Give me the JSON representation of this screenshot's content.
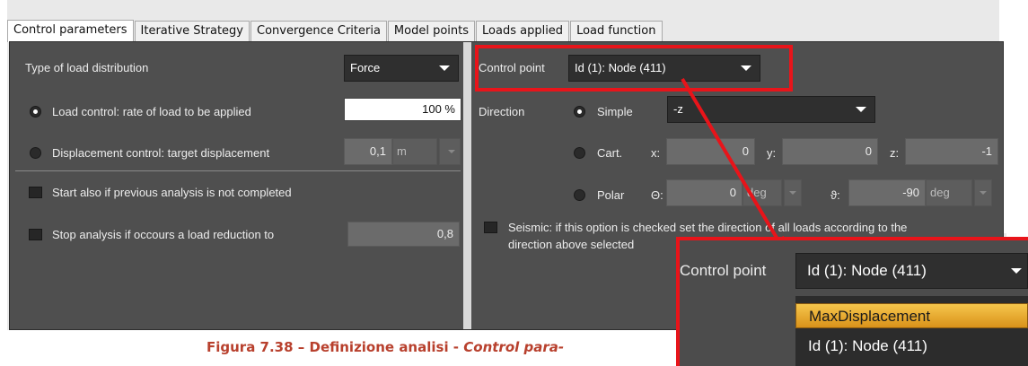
{
  "tabs": [
    "Control parameters",
    "Iterative Strategy",
    "Convergence Criteria",
    "Model points",
    "Loads applied",
    "Load function"
  ],
  "active_tab": "Control parameters",
  "left": {
    "load_distribution_label": "Type of load distribution",
    "load_distribution_value": "Force",
    "load_control_label": "Load control: rate of load to be applied",
    "load_control_value": "100 %",
    "displacement_control_label": "Displacement control: target displacement",
    "displacement_value": "0,1",
    "displacement_unit": "m",
    "start_also_label": "Start also if previous analysis is not completed",
    "stop_analysis_label": "Stop analysis if occours a load reduction to",
    "stop_analysis_value": "0,8"
  },
  "right": {
    "control_point_label": "Control point",
    "control_point_value": "Id (1): Node (411)",
    "direction_label": "Direction",
    "simple_label": "Simple",
    "simple_value": "-z",
    "cart_label": "Cart.",
    "x_label": "x:",
    "x_value": "0",
    "y_label": "y:",
    "y_value": "0",
    "z_label": "z:",
    "z_value": "-1",
    "polar_label": "Polar",
    "theta_label": "Θ:",
    "theta_value": "0",
    "theta_unit": "deg",
    "phi_label": "ϑ:",
    "phi_value": "-90",
    "phi_unit": "deg",
    "seismic_label_1": "Seismic: if this option is checked set the direction of all loads according to the",
    "seismic_label_2": "direction above selected"
  },
  "zoom": {
    "control_point_label": "Control point",
    "control_point_value": "Id (1): Node (411)",
    "options": [
      "MaxDisplacement",
      "Id (1): Node (411)"
    ]
  },
  "caption": {
    "prefix": "Figura 7.38 – Definizione analisi - ",
    "italic": "Control para-"
  },
  "colors": {
    "panel_bg": "#4f4f4f",
    "highlight_red": "#e8141a",
    "caption_color": "#b8402d",
    "menu_highlight": "#f6c64c"
  }
}
